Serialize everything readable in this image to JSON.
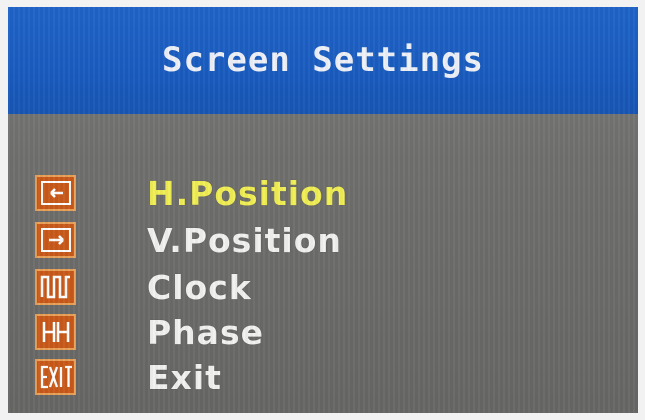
{
  "header": {
    "title": "Screen Settings"
  },
  "menu": {
    "items": [
      {
        "label": "H.Position",
        "icon": "h-position-icon",
        "selected": true
      },
      {
        "label": "V.Position",
        "icon": "v-position-icon",
        "selected": false
      },
      {
        "label": "Clock",
        "icon": "clock-icon",
        "selected": false
      },
      {
        "label": "Phase",
        "icon": "phase-icon",
        "selected": false
      },
      {
        "label": "Exit",
        "icon": "exit-icon",
        "selected": false
      }
    ]
  },
  "colors": {
    "header_bg": "#1a5cc0",
    "panel_bg": "#6f6f6d",
    "selected_text": "#f2f055",
    "text": "#f2f2f0",
    "icon_bg": "#c85a1a"
  }
}
